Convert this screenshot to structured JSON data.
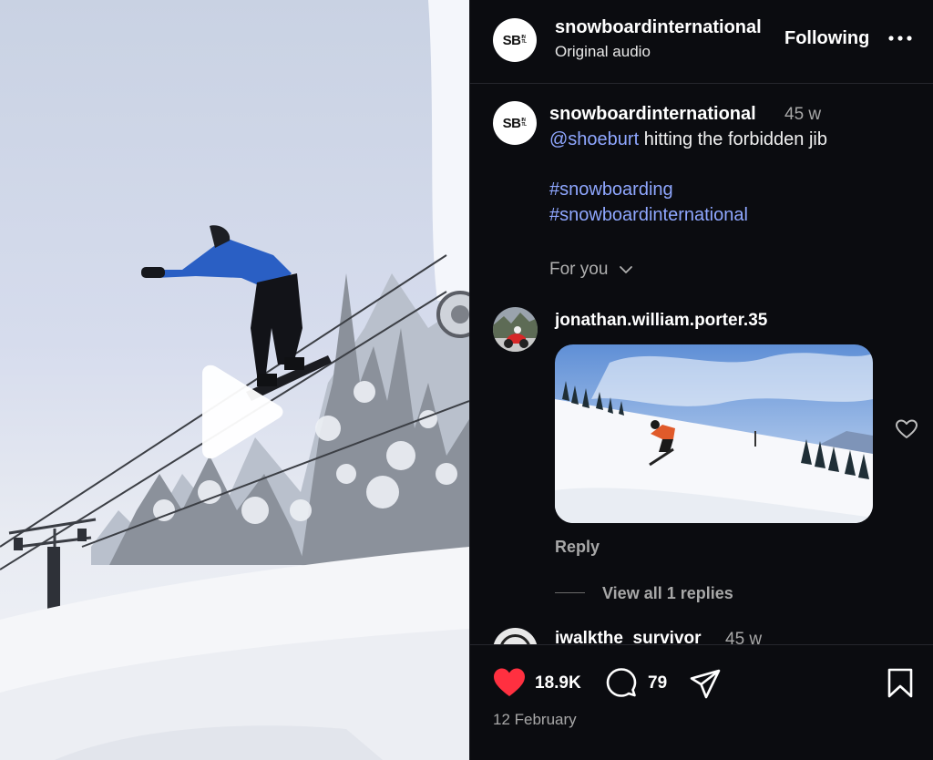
{
  "post": {
    "account": "snowboardinternational",
    "audio": "Original audio",
    "follow_label": "Following",
    "avatar_text": "SB",
    "avatar_sup": "INTL"
  },
  "caption": {
    "account": "snowboardinternational",
    "time": "45 w",
    "mention": "@shoeburt",
    "text": " hitting the forbidden jib",
    "hashtags": [
      "#snowboarding",
      "#snowboardinternational"
    ]
  },
  "feed_filter": "For you",
  "comments": [
    {
      "username": "jonathan.william.porter.35",
      "reply_label": "Reply",
      "view_replies_label": "View all 1 replies"
    },
    {
      "username": "iwalkthe_survivor",
      "time": "45 w"
    }
  ],
  "actions": {
    "likes": "18.9K",
    "comments": "79",
    "like_color": "#ff3040"
  },
  "date": "12 February",
  "icons": [
    "play-icon",
    "more-icon",
    "chevron-down-icon",
    "heart-icon",
    "comment-icon",
    "share-icon",
    "bookmark-icon"
  ]
}
